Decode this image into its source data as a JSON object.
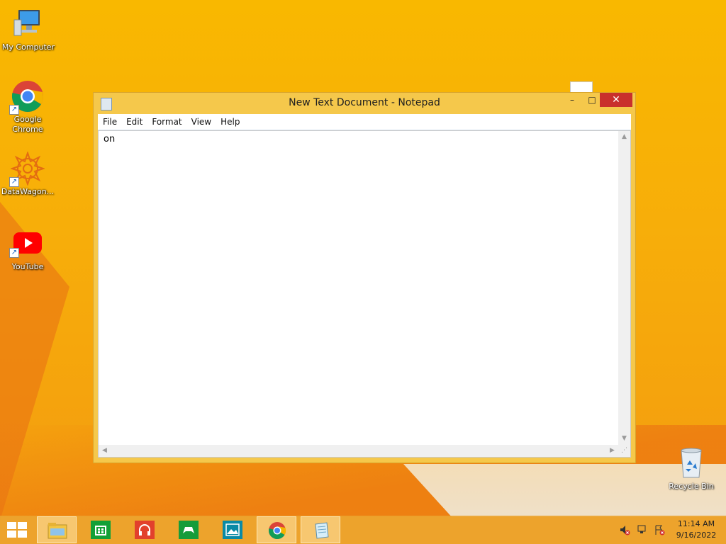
{
  "desktop": {
    "icons": [
      {
        "label": "My Computer",
        "icon": "computer-icon"
      },
      {
        "label": "Google Chrome",
        "icon": "chrome-icon"
      },
      {
        "label": "DataWagon...",
        "icon": "datawagon-icon"
      },
      {
        "label": "YouTube",
        "icon": "youtube-icon"
      },
      {
        "label": "Recycle Bin",
        "icon": "recycle-bin-icon"
      }
    ]
  },
  "window": {
    "title": "New Text Document - Notepad",
    "controls": {
      "minimize": "–",
      "maximize": "□",
      "close": "✕"
    },
    "menu": [
      "File",
      "Edit",
      "Format",
      "View",
      "Help"
    ],
    "content": "on"
  },
  "taskbar": {
    "apps": [
      {
        "name": "File Explorer",
        "icon": "folder-icon"
      },
      {
        "name": "Store",
        "icon": "store-icon"
      },
      {
        "name": "Music",
        "icon": "headphones-icon"
      },
      {
        "name": "Games",
        "icon": "gamepad-icon"
      },
      {
        "name": "Photos",
        "icon": "photos-icon"
      },
      {
        "name": "Google Chrome",
        "icon": "chrome-icon"
      },
      {
        "name": "Notepad",
        "icon": "notepad-icon"
      }
    ],
    "clock": {
      "time": "11:14 AM",
      "date": "9/16/2022"
    }
  },
  "colors": {
    "desktop_bg": "#f9b800",
    "window_frame": "#f5c84b",
    "close_button": "#c9302c",
    "taskbar": "#eca42e"
  }
}
